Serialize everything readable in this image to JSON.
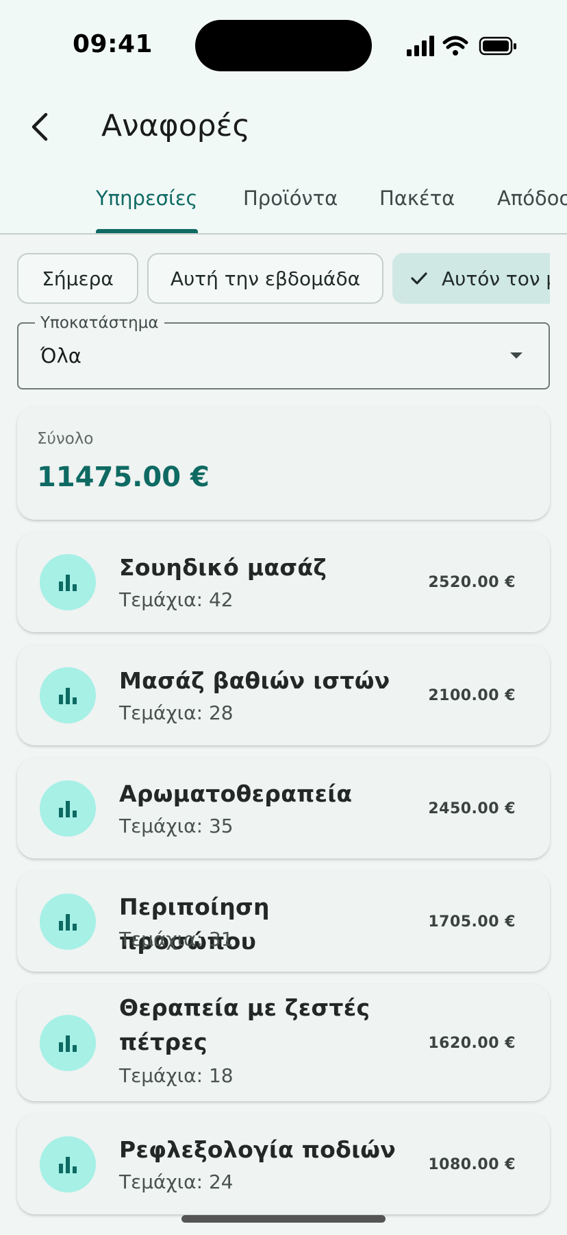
{
  "status_bar": {
    "time": "09:41"
  },
  "app_bar": {
    "title": "Αναφορές",
    "back_icon": "chevron-left-icon"
  },
  "tabs": [
    {
      "label": "Υπηρεσίες",
      "active": true
    },
    {
      "label": "Προϊόντα",
      "active": false
    },
    {
      "label": "Πακέτα",
      "active": false
    },
    {
      "label": "Απόδοση",
      "active": false
    }
  ],
  "filters": {
    "chips": [
      {
        "label": "Σήμερα",
        "selected": false
      },
      {
        "label": "Αυτή την εβδομάδα",
        "selected": false
      },
      {
        "label": "Αυτόν τον μήνα",
        "selected": true
      }
    ]
  },
  "branch_select": {
    "label": "Υποκατάστημα",
    "value": "Όλα"
  },
  "total": {
    "label": "Σύνολο",
    "value": "11475.00 €"
  },
  "services": [
    {
      "name": "Σουηδικό μασάζ",
      "quantity": "Τεμάχια: 42",
      "amount": "2520.00 €"
    },
    {
      "name": "Μασάζ βαθιών ιστών",
      "quantity": "Τεμάχια: 28",
      "amount": "2100.00 €"
    },
    {
      "name": "Αρωματοθεραπεία",
      "quantity": "Τεμάχια: 35",
      "amount": "2450.00 €"
    },
    {
      "name": "Περιποίηση προσώπου",
      "quantity": "Τεμάχια: 31",
      "amount": "1705.00 €"
    },
    {
      "name": "Θεραπεία με ζεστές πέτρες",
      "quantity": "Τεμάχια: 18",
      "amount": "1620.00 €"
    },
    {
      "name": "Ρεφλεξολογία ποδιών",
      "quantity": "Τεμάχια: 24",
      "amount": "1080.00 €"
    }
  ],
  "colors": {
    "primary": "#0e6a63",
    "avatar_bg": "#a6f0e6",
    "chip_selected_bg": "#cfe8e4",
    "background": "#f1f5f4"
  }
}
